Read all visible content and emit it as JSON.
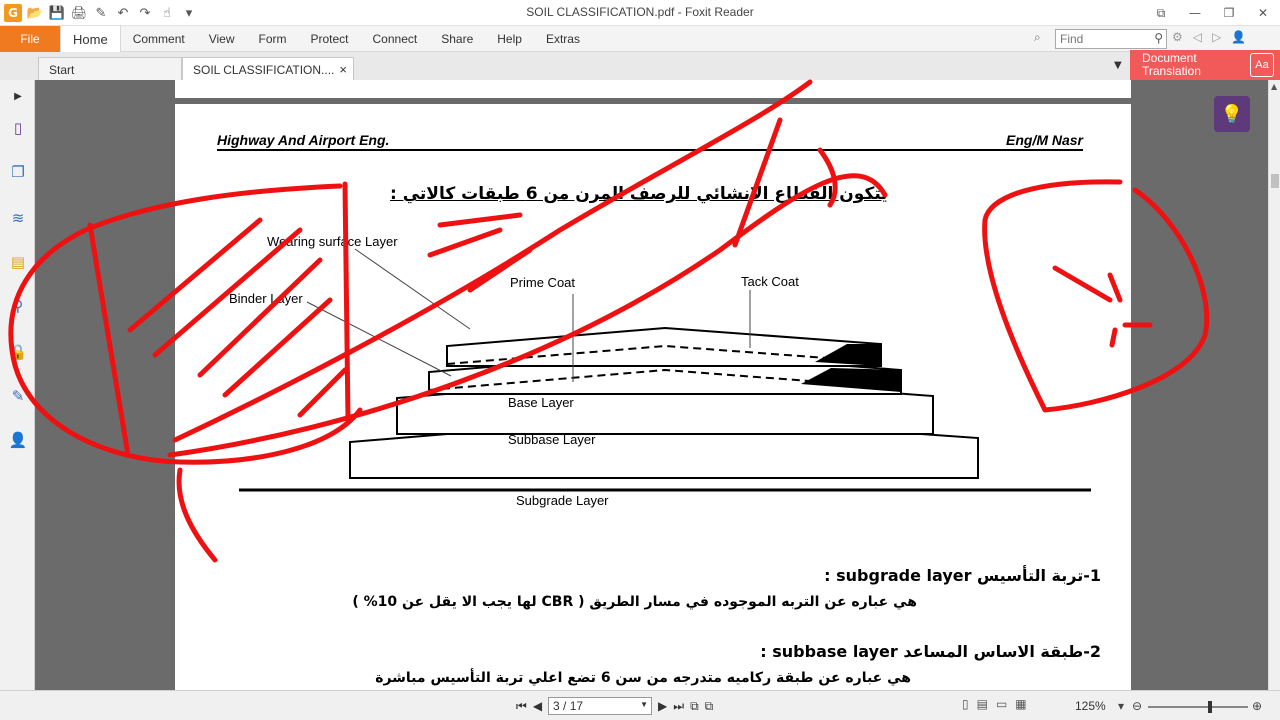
{
  "window": {
    "title": "SOIL CLASSIFICATION.pdf - Foxit Reader",
    "controls": [
      "⧉",
      "—",
      "❐",
      "✕"
    ]
  },
  "quick_access": [
    "G",
    "📂",
    "💾",
    "🖨",
    "✎",
    "↶",
    "↷",
    "☝",
    "▾"
  ],
  "ribbon": {
    "file": "File",
    "tabs": [
      "Home",
      "Comment",
      "View",
      "Form",
      "Protect",
      "Connect",
      "Share",
      "Help",
      "Extras"
    ],
    "active_tab": "Home",
    "search_placeholder": "Find"
  },
  "tabs": [
    {
      "label": "Start"
    },
    {
      "label": "SOIL CLASSIFICATION....",
      "close": "×"
    }
  ],
  "doc_translation": {
    "line1": "Document",
    "line2": "Translation",
    "icon_text": "Aa"
  },
  "document": {
    "header_left": "Highway And Airport Eng.",
    "header_right": "Eng/M Nasr",
    "arabic_title": "يتكون القطاع الانشائي للرصف المرن من 6 طبقات كالاتي :",
    "labels": {
      "wearing": "Wearing surface Layer",
      "binder": "Binder Layer",
      "prime": "Prime Coat",
      "tack": "Tack Coat",
      "base": "Base Layer",
      "subbase": "Subbase Layer",
      "subgrade": "Subgrade Layer"
    },
    "item1_heading": "1-تربة التأسيس  subgrade layer  :",
    "item1_text": "هي عباره عن التربه الموجوده في مسار الطريق ( CBR لها يجب الا يقل عن 10% )",
    "item2_heading": "2-طبقة الاساس المساعد  subbase layer  :",
    "item2_text": "هي عباره عن طبقة ركاميه متدرجه من سن 6 تضع اعلي تربة التأسيس مباشرة"
  },
  "statusbar": {
    "page_field": "3 / 17",
    "zoom": "125%",
    "zoom_level_fraction": 0.62
  },
  "colors": {
    "file_tab": "#f07a1f",
    "ink": "#ee1111",
    "doc_translation": "#f25a5a"
  }
}
